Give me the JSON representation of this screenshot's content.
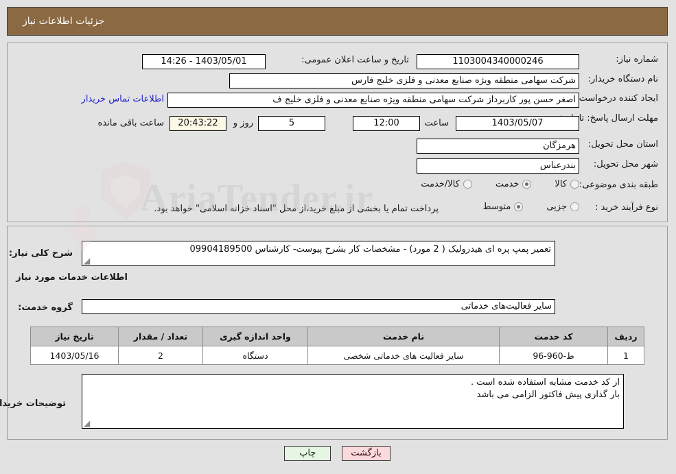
{
  "header": {
    "title": "جزئیات اطلاعات نیاز",
    "bg_color": "#8b6a43"
  },
  "watermark": {
    "text": "AriaTender.ir"
  },
  "top_form": {
    "need_number": {
      "label": "شماره نیاز:",
      "value": "1103004340000246"
    },
    "announce_datetime": {
      "label": "تاریخ و ساعت اعلان عمومی:",
      "value": "1403/05/01 - 14:26"
    },
    "buyer_org": {
      "label": "نام دستگاه خریدار:",
      "value": "شرکت سهامی منطقه ویژه صنایع معدنی و فلزی خلیج فارس"
    },
    "requester": {
      "label": "ایجاد کننده درخواست:",
      "value": "اصغر حسن پور کاربرداز شرکت سهامی منطقه ویژه صنایع معدنی و فلزی خلیج ف",
      "contact_link": "اطلاعات تماس خریدار"
    },
    "deadline": {
      "label": "مهلت ارسال پاسخ: تا تاریخ:",
      "date": "1403/05/07",
      "hour_label": "ساعت",
      "hour": "12:00",
      "days": "5",
      "days_label": "روز و",
      "countdown": "20:43:22",
      "countdown_label": "ساعت باقی مانده"
    },
    "province": {
      "label": "استان محل تحویل:",
      "value": "هرمزگان"
    },
    "city": {
      "label": "شهر محل تحویل:",
      "value": "بندرعباس"
    },
    "category": {
      "label": "طبقه بندی موضوعی:",
      "options": [
        {
          "text": "کالا",
          "selected": false
        },
        {
          "text": "خدمت",
          "selected": true
        },
        {
          "text": "کالا/خدمت",
          "selected": false
        }
      ]
    },
    "purchase_type": {
      "label": "نوع فرآیند خرید :",
      "options": [
        {
          "text": "جزیی",
          "selected": false
        },
        {
          "text": "متوسط",
          "selected": true
        }
      ],
      "note": "پرداخت تمام یا بخشی از مبلغ خرید،از محل \"اسناد خزانه اسلامی\" خواهد بود."
    }
  },
  "middle": {
    "need_description": {
      "label": "شرح کلی نیاز:",
      "value": "تعمیر پمپ پره ای هیدرولیک  ( 2 مورد) - مشخصات کار بشرح پیوست- کارشناس 09904189500"
    },
    "services_section_title": "اطلاعات خدمات مورد نیاز",
    "service_group": {
      "label": "گروه خدمت:",
      "value": "سایر فعالیت‌های خدماتی"
    },
    "table": {
      "headers": [
        "ردیف",
        "کد خدمت",
        "نام خدمت",
        "واحد اندازه گیری",
        "تعداد / مقدار",
        "تاریخ نیاز"
      ],
      "rows": [
        [
          "1",
          "ط-960-96",
          "سایر فعالیت های خدماتی شخصی",
          "دستگاه",
          "2",
          "1403/05/16"
        ]
      ]
    },
    "buyer_notes": {
      "label": "توضیحات خریدار:",
      "lines": [
        "از کد خدمت مشابه استفاده شده است .",
        "بار گذاری پیش فاکتور الزامی می باشد"
      ]
    }
  },
  "footer": {
    "print_button": "چاپ",
    "back_button": "بازگشت"
  }
}
